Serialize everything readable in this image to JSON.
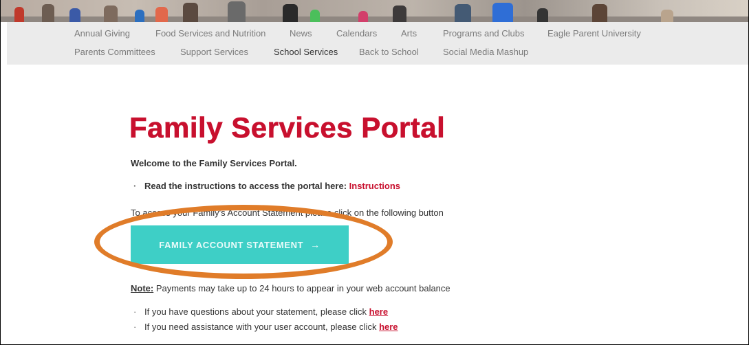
{
  "nav": {
    "row1": [
      "Annual Giving",
      "Food Services and Nutrition",
      "News",
      "Calendars",
      "Arts",
      "Programs and Clubs",
      "Eagle Parent University"
    ],
    "row2": [
      "Parents Committees",
      "Support Services",
      "School Services",
      "Back to School",
      "Social Media Mashup"
    ],
    "active": "School Services"
  },
  "page": {
    "title": "Family Services Portal",
    "welcome": "Welcome to the Family Services Portal.",
    "instructions_text": "Read the instructions to access the portal here: ",
    "instructions_link": "Instructions",
    "access_text": "To access your Family's Account Statement please click on the following button",
    "button_label": "FAMILY ACCOUNT STATEMENT",
    "button_arrow": "→",
    "note_label": "Note:",
    "note_text": " Payments may take up to 24 hours to appear in your web account balance",
    "question_text": "If you have questions about your statement, please click ",
    "assist_text": "If you need assistance with your user account, please click ",
    "here_label": "here",
    "bullet": "·"
  },
  "colors": {
    "accent_red": "#c8102e",
    "button_teal": "#3ecfc6",
    "highlight_orange": "#e07c29",
    "nav_bg": "#ebebeb"
  }
}
